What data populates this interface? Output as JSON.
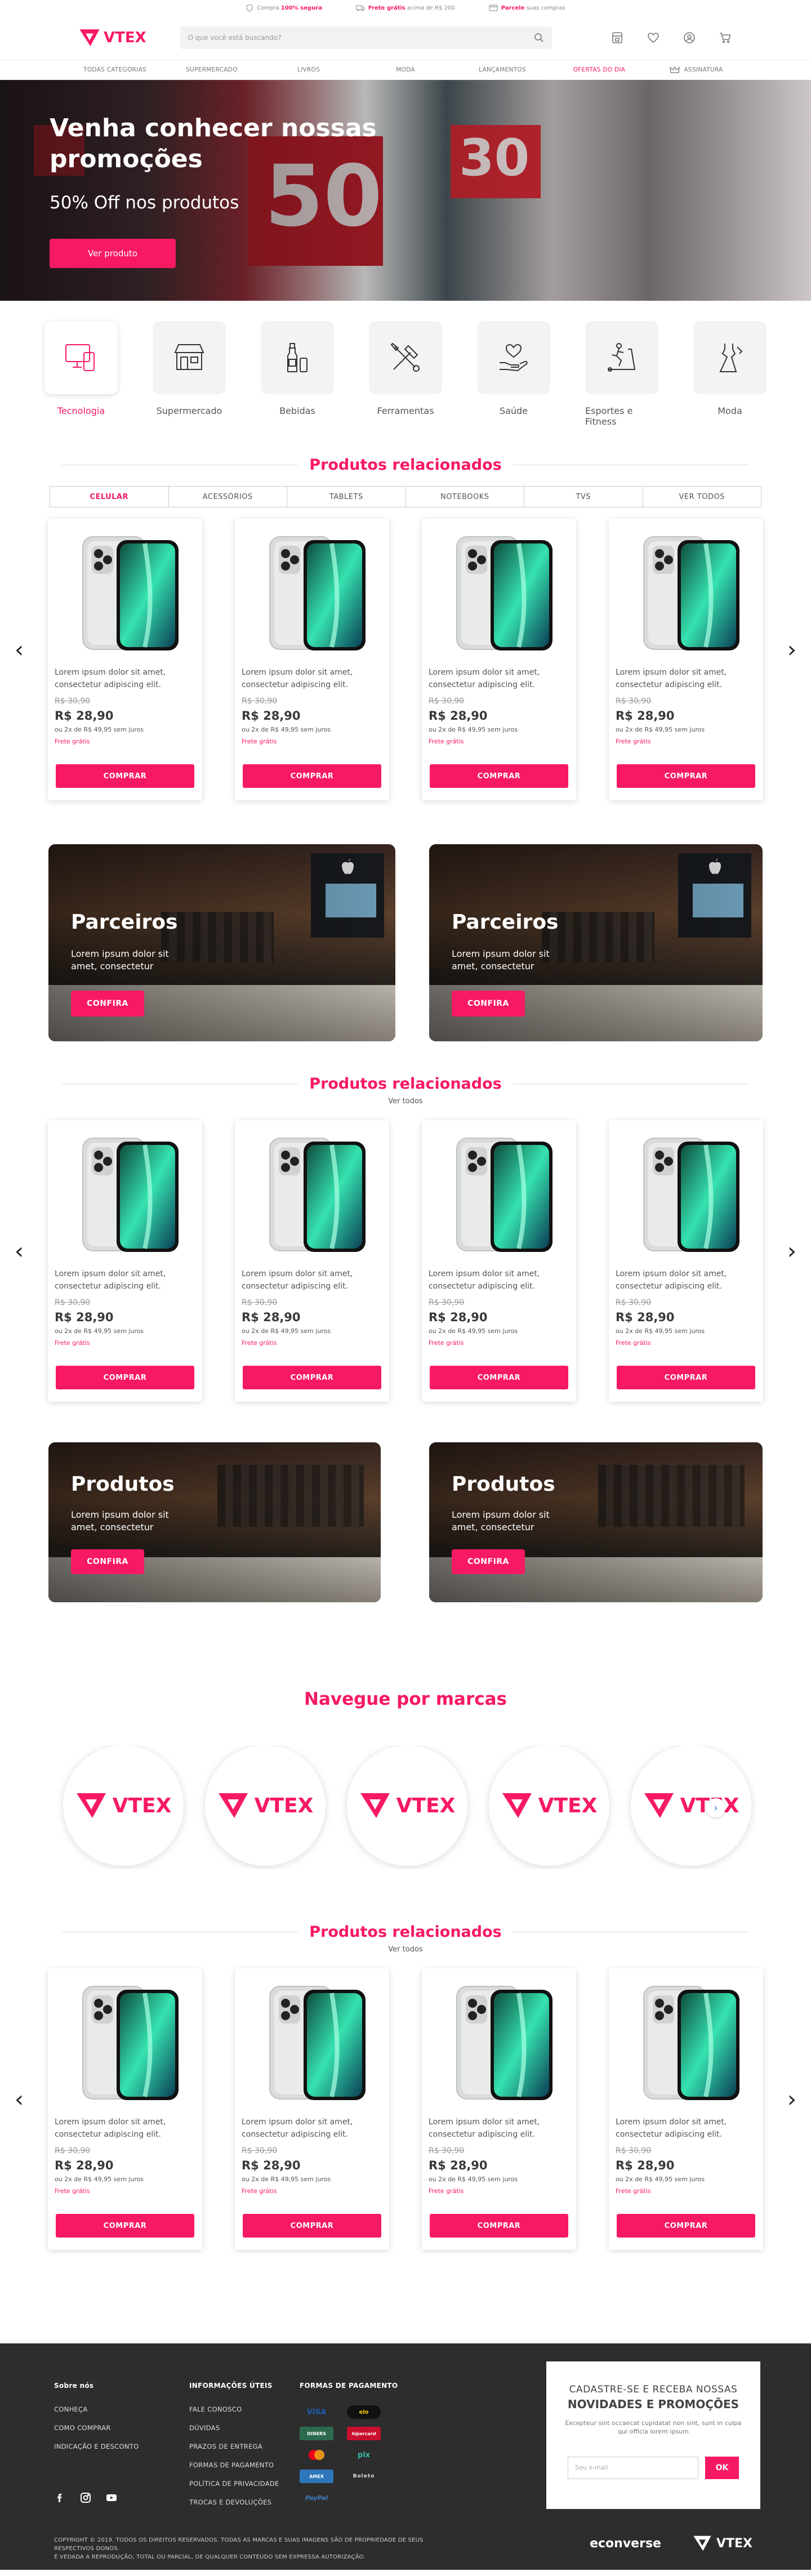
{
  "topbar": {
    "items": [
      {
        "icon": "shield-icon",
        "pre": "Compra",
        "bold": "100% segura",
        "post": ""
      },
      {
        "icon": "truck-icon",
        "pre": "",
        "bold": "Frete grátis",
        "post": "acima de R$ 200"
      },
      {
        "icon": "card-icon",
        "pre": "",
        "bold": "Parcele",
        "post": "suas compras"
      }
    ]
  },
  "header": {
    "logo_text": "VTEX",
    "search_placeholder": "O que você está buscando?"
  },
  "nav": {
    "items": [
      "TODAS CATEGORIAS",
      "SUPERMERCADO",
      "LIVROS",
      "MODA",
      "LANÇAMENTOS",
      "OFERTAS DO DIA",
      "ASSINATURA"
    ]
  },
  "hero": {
    "title": "Venha conhecer nossas promoções",
    "subtitle": "50% Off nos produtos",
    "button": "Ver produto"
  },
  "categories": [
    {
      "label": "Tecnologia",
      "icon": "devices-icon"
    },
    {
      "label": "Supermercado",
      "icon": "store-icon"
    },
    {
      "label": "Bebidas",
      "icon": "bottle-icon"
    },
    {
      "label": "Ferramentas",
      "icon": "tools-icon"
    },
    {
      "label": "Saúde",
      "icon": "heart-hand-icon"
    },
    {
      "label": "Esportes e Fitness",
      "icon": "treadmill-icon"
    },
    {
      "label": "Moda",
      "icon": "dress-icon"
    }
  ],
  "section1": {
    "title": "Produtos relacionados",
    "tabs": [
      "CELULAR",
      "ACESSÓRIOS",
      "TABLETS",
      "NOTEBOOKS",
      "TVS",
      "VER TODOS"
    ]
  },
  "product": {
    "name": "Lorem ipsum dolor sit amet, consectetur adipiscing elit.",
    "old_price": "R$ 30,90",
    "price": "R$ 28,90",
    "installments": "ou 2x de R$ 49,95 sem juros",
    "shipping": "Frete grátis",
    "button": "COMPRAR"
  },
  "banners1": [
    {
      "title": "Parceiros",
      "text": "Lorem ipsum dolor sit amet, consectetur",
      "button": "CONFIRA"
    },
    {
      "title": "Parceiros",
      "text": "Lorem ipsum dolor sit amet, consectetur",
      "button": "CONFIRA"
    }
  ],
  "section2": {
    "title": "Produtos relacionados",
    "link": "Ver todos"
  },
  "banners2": [
    {
      "title": "Produtos",
      "text": "Lorem ipsum dolor sit amet, consectetur",
      "button": "CONFIRA"
    },
    {
      "title": "Produtos",
      "text": "Lorem ipsum dolor sit amet, consectetur",
      "button": "CONFIRA"
    }
  ],
  "brands": {
    "title": "Navegue por marcas",
    "brand_text": "VTEX"
  },
  "section3": {
    "title": "Produtos relacionados",
    "link": "Ver todos"
  },
  "footer": {
    "about": {
      "title": "Sobre nós",
      "items": [
        "CONHEÇA",
        "COMO COMPRAR",
        "INDICAÇÃO E DESCONTO"
      ]
    },
    "info": {
      "title": "INFORMAÇÕES ÚTEIS",
      "items": [
        "FALE CONOSCO",
        "DÚVIDAS",
        "PRAZOS DE ENTREGA",
        "FORMAS DE PAGAMENTO",
        "POLÍTICA DE PRIVACIDADE",
        "TROCAS E DEVOLUÇÕES"
      ]
    },
    "payments": {
      "title": "FORMAS DE PAGAMENTO",
      "items": [
        "VISA",
        "elo",
        "DINERS",
        "hipercard",
        "MasterCard",
        "pix",
        "AMEX",
        "Boleto",
        "PayPal"
      ]
    },
    "newsletter": {
      "line1": "CADASTRE-SE E RECEBA NOSSAS",
      "line2": "NOVIDADES E PROMOÇÕES",
      "text": "Excepteur sint occaecat cupidatat non sint, sunt in culpa qui officia lorem ipsum",
      "placeholder": "Seu e-mail",
      "button": "OK"
    },
    "copyright1": "COPYRIGHT © 2019. TODOS OS DIREITOS RESERVADOS. TODAS AS MARCAS E SUAS IMAGENS SÃO DE PROPRIEDADE DE SEUS RESPECTIVOS DONOS.",
    "copyright2": "É VEDADA A REPRODUÇÃO, TOTAL OU PARCIAL, DE QUALQUER CONTEÚDO SEM EXPRESSA AUTORIZAÇÃO.",
    "logo1": "econverse",
    "logo2": "VTEX"
  },
  "colors": {
    "accent": "#f71963",
    "footer_bg": "#2d2d2d"
  }
}
